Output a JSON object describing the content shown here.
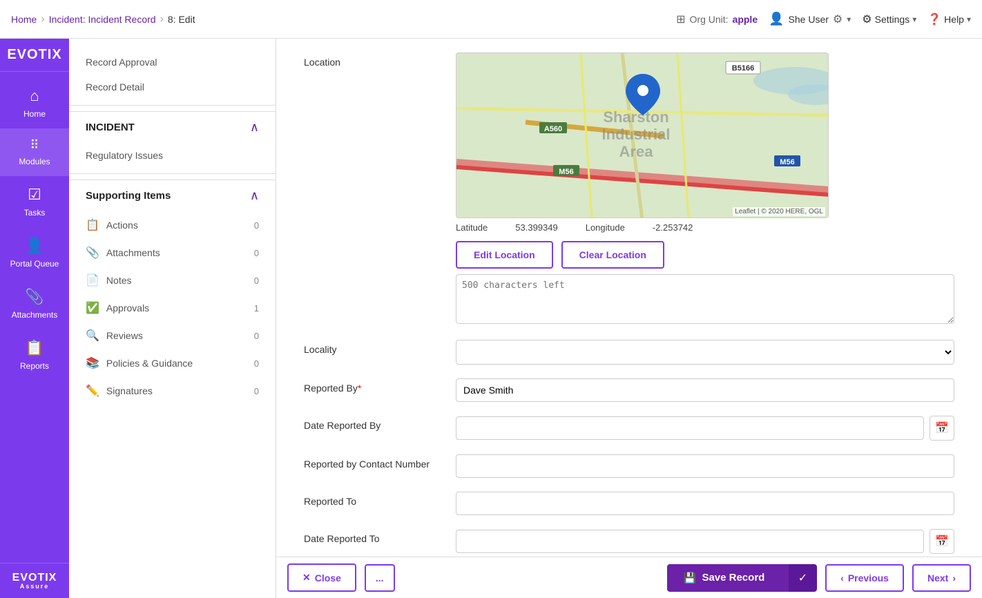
{
  "topnav": {
    "breadcrumb": {
      "home": "Home",
      "incident": "Incident: Incident Record",
      "current": "8: Edit"
    },
    "org_unit_label": "Org Unit:",
    "org_unit_value": "apple",
    "user_name": "She User",
    "settings_label": "Settings",
    "help_label": "Help"
  },
  "sidebar": {
    "logo_top": "EVOTIX",
    "items": [
      {
        "id": "home",
        "label": "Home",
        "icon": "⌂"
      },
      {
        "id": "modules",
        "label": "Modules",
        "icon": "⋮⋮⋮"
      },
      {
        "id": "tasks",
        "label": "Tasks",
        "icon": "✓"
      },
      {
        "id": "portal-queue",
        "label": "Portal Queue",
        "icon": "👤"
      },
      {
        "id": "attachments",
        "label": "Attachments",
        "icon": "📎"
      },
      {
        "id": "reports",
        "label": "Reports",
        "icon": "📋"
      }
    ],
    "logo_bottom_main": "EVOTIX",
    "logo_bottom_sub": "Assure"
  },
  "left_panel": {
    "nav_items": [
      {
        "id": "record-approval",
        "label": "Record Approval"
      },
      {
        "id": "record-detail",
        "label": "Record Detail"
      }
    ],
    "incident_section": {
      "title": "INCIDENT",
      "items": [
        {
          "id": "regulatory-issues",
          "label": "Regulatory Issues"
        }
      ]
    },
    "supporting_items_section": {
      "title": "Supporting Items",
      "items": [
        {
          "id": "actions",
          "label": "Actions",
          "count": "0",
          "icon": "📋"
        },
        {
          "id": "attachments",
          "label": "Attachments",
          "count": "0",
          "icon": "📎"
        },
        {
          "id": "notes",
          "label": "Notes",
          "count": "0",
          "icon": "📄"
        },
        {
          "id": "approvals",
          "label": "Approvals",
          "count": "1",
          "icon": "✅"
        },
        {
          "id": "reviews",
          "label": "Reviews",
          "count": "0",
          "icon": "🔍"
        },
        {
          "id": "policies",
          "label": "Policies & Guidance",
          "count": "0",
          "icon": "📚"
        },
        {
          "id": "signatures",
          "label": "Signatures",
          "count": "0",
          "icon": "✏️"
        }
      ]
    }
  },
  "form": {
    "location_label": "Location",
    "latitude_label": "Latitude",
    "latitude_value": "53.399349",
    "longitude_label": "Longitude",
    "longitude_value": "-2.253742",
    "edit_location_btn": "Edit Location",
    "clear_location_btn": "Clear Location",
    "notes_placeholder": "500 characters left",
    "locality_label": "Locality",
    "reported_by_label": "Reported By",
    "reported_by_required": "*",
    "reported_by_value": "Dave Smith",
    "date_reported_label": "Date Reported By",
    "reported_contact_label": "Reported by Contact Number",
    "reported_to_label": "Reported To",
    "date_reported_to_label": "Date Reported To",
    "map_area": "Sharston Industrial Area",
    "map_road1": "A560",
    "map_road2": "M56",
    "map_road3": "B5166",
    "leaflet_text": "Leaflet | © 2020 HERE, OGL"
  },
  "bottom_bar": {
    "close_label": "Close",
    "more_label": "...",
    "save_label": "Save Record",
    "previous_label": "Previous",
    "next_label": "Next"
  }
}
